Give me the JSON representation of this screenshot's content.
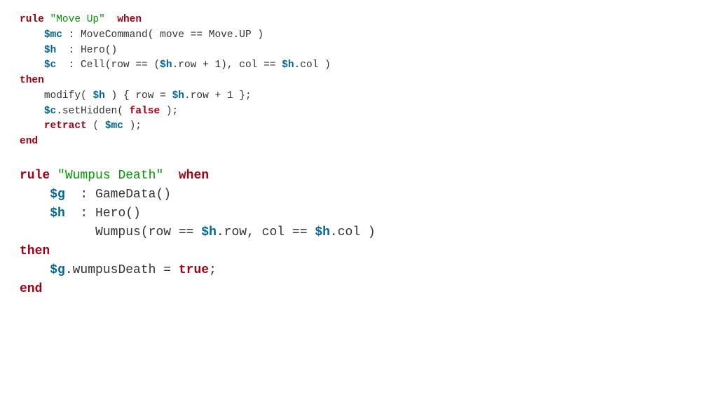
{
  "block1": {
    "kw_rule": "rule",
    "rule_name": "\"Move Up\"",
    "kw_when": "when",
    "l2_var": "$mc",
    "l2_rest": " : MoveCommand( move == Move.UP )",
    "l3_var": "$h",
    "l3_rest": "  : Hero()",
    "l4_var": "$c",
    "l4_a": "  : Cell(row == (",
    "l4_var2": "$h",
    "l4_b": ".row + 1), col == ",
    "l4_var3": "$h",
    "l4_c": ".col )",
    "kw_then": "then",
    "l6_a": "modify( ",
    "l6_var": "$h",
    "l6_b": " ) { row = ",
    "l6_var2": "$h",
    "l6_c": ".row + 1 };",
    "l7_var": "$c",
    "l7_a": ".setHidden( ",
    "l7_bool": "false",
    "l7_b": " );",
    "l8_kw": "retract",
    "l8_a": " ( ",
    "l8_var": "$mc",
    "l8_b": " );",
    "kw_end": "end"
  },
  "block2": {
    "kw_rule": "rule",
    "rule_name": "\"Wumpus Death\"",
    "kw_when": "when",
    "l2_var": "$g",
    "l2_rest": "  : GameData()",
    "l3_var": "$h",
    "l3_rest": "  : Hero()",
    "l4_a": "Wumpus(row == ",
    "l4_var": "$h",
    "l4_b": ".row, col == ",
    "l4_var2": "$h",
    "l4_c": ".col )",
    "kw_then": "then",
    "l6_var": "$g",
    "l6_a": ".wumpusDeath = ",
    "l6_bool": "true",
    "l6_b": ";",
    "kw_end": "end"
  }
}
